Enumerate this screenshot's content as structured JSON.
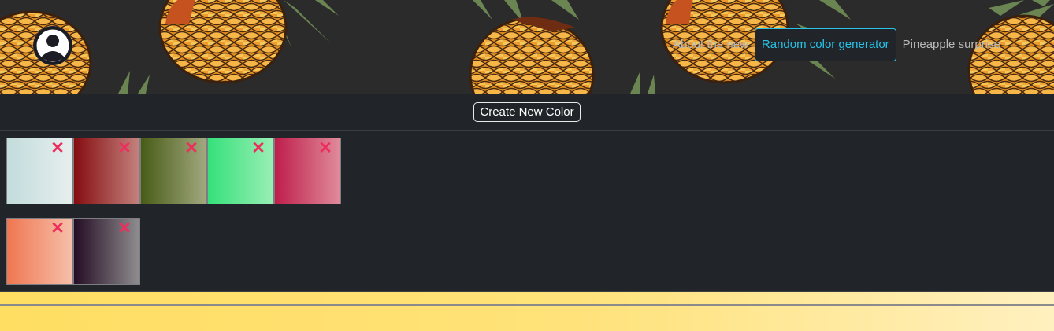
{
  "header": {
    "nav": [
      {
        "label": "About the new",
        "active": false
      },
      {
        "label": "Random color generator",
        "active": true
      },
      {
        "label": "Pineapple surprise",
        "active": false
      }
    ]
  },
  "toolbar": {
    "create_label": "Create New Color"
  },
  "palettes": [
    [
      {
        "from": "#c3dcdc",
        "to": "#e6efee"
      },
      {
        "from": "#850d10",
        "to": "#c4827e"
      },
      {
        "from": "#485c16",
        "to": "#a1a87f"
      },
      {
        "from": "#35e07a",
        "to": "#99efb5"
      },
      {
        "from": "#be1e4b",
        "to": "#e08b9b"
      }
    ],
    [
      {
        "from": "#ef7651",
        "to": "#f6c0aa"
      },
      {
        "from": "#240d24",
        "to": "#8f8d8f"
      }
    ]
  ],
  "icons": {
    "delete": "close-icon",
    "avatar": "user-icon"
  },
  "colors": {
    "accent": "#27c3e8",
    "delete": "#ec2f5c",
    "background": "#212428",
    "footer": "#ffde62"
  }
}
